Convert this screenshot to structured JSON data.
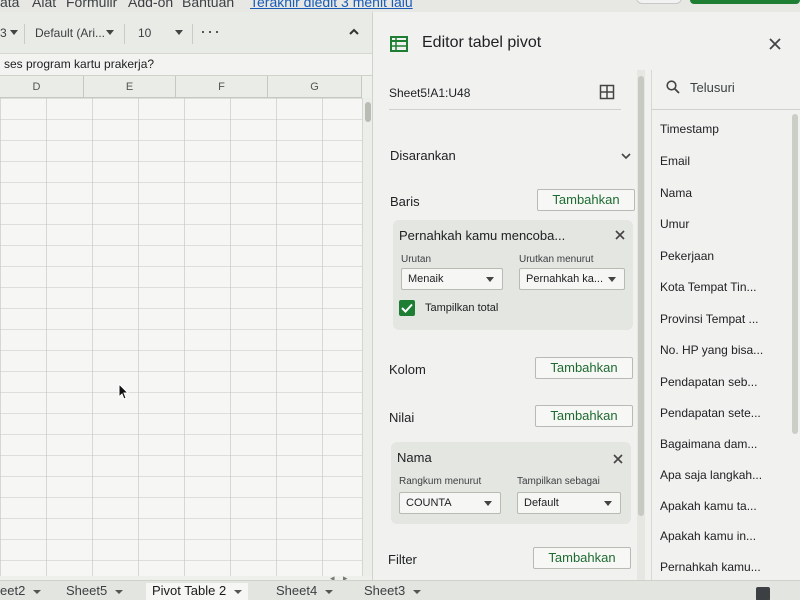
{
  "menu": {
    "items": [
      "ata",
      "Alat",
      "Formulir",
      "Add-on",
      "Bantuan"
    ],
    "last_edit": "Terakhir diedit 3 menit lalu"
  },
  "toolbar": {
    "partial_left": "3",
    "font": "Default (Ari...",
    "font_size": "10",
    "more": "···"
  },
  "formula_bar": {
    "text": "ses program kartu prakerja?"
  },
  "columns": [
    "D",
    "E",
    "F",
    "G"
  ],
  "sheet_tabs": [
    {
      "label": "eet2",
      "active": false
    },
    {
      "label": "Sheet5",
      "active": false
    },
    {
      "label": "Pivot Table 2",
      "active": true
    },
    {
      "label": "Sheet4",
      "active": false
    },
    {
      "label": "Sheet3",
      "active": false
    }
  ],
  "scroll_arrows": {
    "left": "◂",
    "right": "▸"
  },
  "pivot_editor": {
    "title": "Editor tabel pivot",
    "range": "Sheet5!A1:U48",
    "suggested_label": "Disarankan",
    "rows": {
      "label": "Baris",
      "add_label": "Tambahkan",
      "card": {
        "title": "Pernahkah kamu mencoba...",
        "order_label": "Urutan",
        "order_value": "Menaik",
        "sort_by_label": "Urutkan menurut",
        "sort_by_value": "Pernahkah ka...",
        "show_totals_label": "Tampilkan total",
        "show_totals_checked": true
      }
    },
    "columns": {
      "label": "Kolom",
      "add_label": "Tambahkan"
    },
    "values": {
      "label": "Nilai",
      "add_label": "Tambahkan",
      "card": {
        "title": "Nama",
        "summarize_label": "Rangkum menurut",
        "summarize_value": "COUNTA",
        "show_as_label": "Tampilkan sebagai",
        "show_as_value": "Default"
      }
    },
    "filter": {
      "label": "Filter",
      "add_label": "Tambahkan"
    },
    "search_placeholder": "Telusuri",
    "fields": [
      "Timestamp",
      "Email",
      "Nama",
      "Umur",
      "Pekerjaan",
      "Kota Tempat Tin...",
      "Provinsi Tempat ...",
      "No. HP yang bisa...",
      "Pendapatan seb...",
      "Pendapatan sete...",
      "Bagaimana dam...",
      "Apa saja langkah...",
      "Apakah kamu ta...",
      "Apakah kamu in...",
      "Pernahkah kamu..."
    ]
  },
  "colors": {
    "accent_green": "#1e7e34",
    "button_text_green": "#1e6b32",
    "link_blue": "#1a5bb8"
  }
}
